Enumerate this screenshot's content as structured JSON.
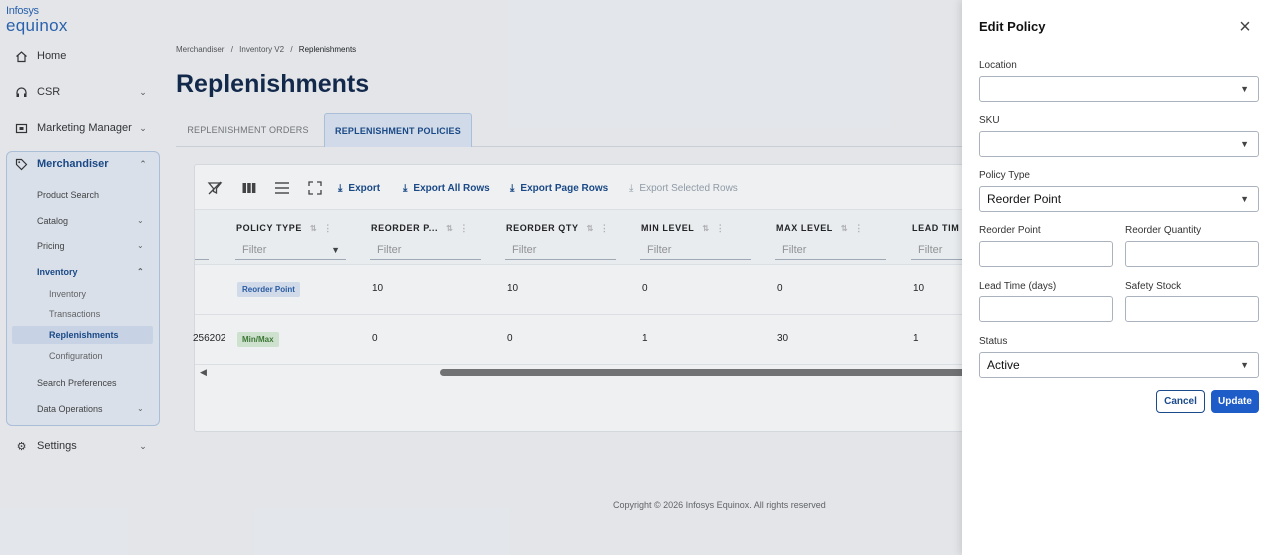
{
  "brand": {
    "line1": "Infosys",
    "line2": "equinox"
  },
  "sidebar": {
    "home": "Home",
    "csr": "CSR",
    "marketing": "Marketing Manager",
    "merchandiser": "Merchandiser",
    "product_search": "Product Search",
    "catalog": "Catalog",
    "pricing": "Pricing",
    "inventory": "Inventory",
    "inventory_sub": [
      "Inventory",
      "Transactions",
      "Replenishments",
      "Configuration"
    ],
    "search_prefs": "Search Preferences",
    "data_ops": "Data Operations",
    "settings": "Settings"
  },
  "breadcrumb": [
    "Merchandiser",
    "/",
    "Inventory V2",
    "/",
    "Replenishments"
  ],
  "page_title": "Replenishments",
  "tabs": [
    "REPLENISHMENT ORDERS",
    "REPLENISHMENT POLICIES"
  ],
  "toolbar": {
    "export": "Export",
    "export_all": "Export All Rows",
    "export_page": "Export Page Rows",
    "export_selected": "Export Selected Rows"
  },
  "columns": [
    "POLICY TYPE",
    "REORDER P...",
    "REORDER QTY",
    "MIN LEVEL",
    "MAX LEVEL",
    "LEAD TIM"
  ],
  "filter_placeholder": "Filter",
  "rows": [
    {
      "lead": "",
      "policy_type": "Reorder Point",
      "reorder_point": "10",
      "reorder_qty": "10",
      "min": "0",
      "max": "0",
      "lead_time": "10"
    },
    {
      "lead": "256202",
      "policy_type": "Min/Max",
      "reorder_point": "0",
      "reorder_qty": "0",
      "min": "1",
      "max": "30",
      "lead_time": "1"
    }
  ],
  "footer": "Copyright © 2026 Infosys Equinox. All rights reserved",
  "drawer": {
    "title": "Edit Policy",
    "location_label": "Location",
    "location_value": "",
    "sku_label": "SKU",
    "sku_value": "",
    "policy_type_label": "Policy Type",
    "policy_type_value": "Reorder Point",
    "reorder_point_label": "Reorder Point",
    "reorder_quantity_label": "Reorder Quantity",
    "lead_time_label": "Lead Time (days)",
    "safety_stock_label": "Safety Stock",
    "status_label": "Status",
    "status_value": "Active",
    "cancel": "Cancel",
    "update": "Update"
  },
  "colors": {
    "accent": "#1e5cc8",
    "title": "#12284b",
    "nav_active": "#1a4a8a"
  }
}
